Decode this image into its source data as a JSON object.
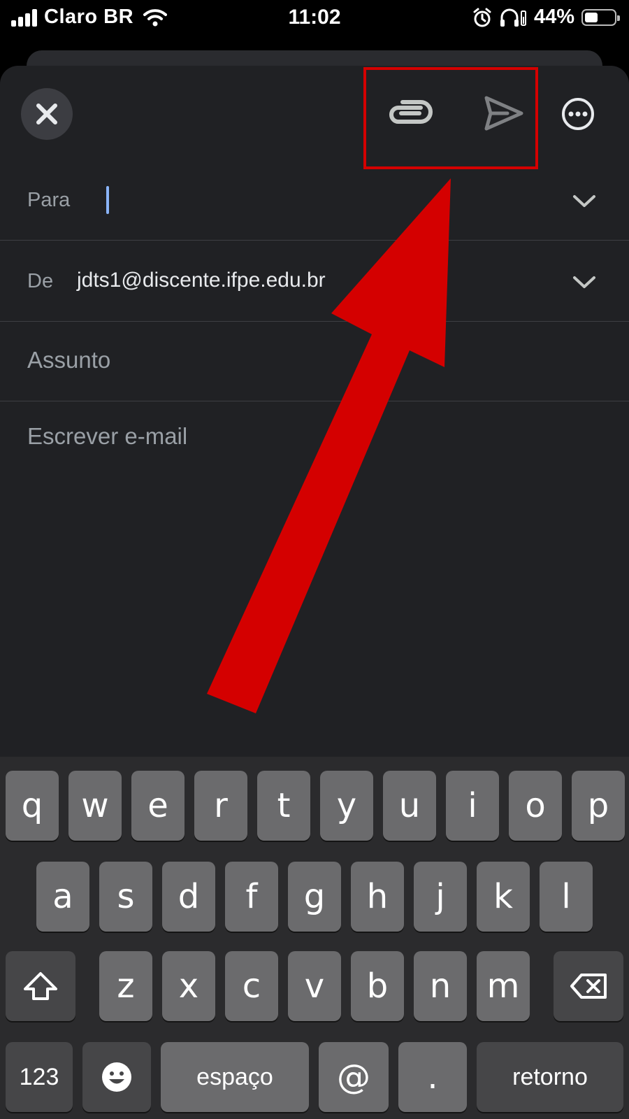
{
  "status_bar": {
    "carrier": "Claro BR",
    "time": "11:02",
    "battery_percent": "44%",
    "battery_level": 0.44,
    "signal_bars": 4
  },
  "toolbar": {
    "close_icon": "close-icon",
    "attach_icon": "paperclip-icon",
    "send_icon": "send-icon",
    "more_icon": "more-horizontal-icon",
    "highlight_color": "#d40000"
  },
  "compose": {
    "to_label": "Para",
    "to_value": "",
    "from_label": "De",
    "from_value": "jdts1@discente.ifpe.edu.br",
    "subject_placeholder": "Assunto",
    "body_placeholder": "Escrever e-mail"
  },
  "annotation": {
    "arrow_color": "#d40000"
  },
  "keyboard": {
    "row1": [
      "q",
      "w",
      "e",
      "r",
      "t",
      "y",
      "u",
      "i",
      "o",
      "p"
    ],
    "row2": [
      "a",
      "s",
      "d",
      "f",
      "g",
      "h",
      "j",
      "k",
      "l"
    ],
    "row3": [
      "z",
      "x",
      "c",
      "v",
      "b",
      "n",
      "m"
    ],
    "numbers_key": "123",
    "emoji_icon": "emoji-icon",
    "space_label": "espaço",
    "at_key": "@",
    "dot_key": ".",
    "return_label": "retorno",
    "shift_icon": "shift-icon",
    "backspace_icon": "backspace-icon"
  }
}
